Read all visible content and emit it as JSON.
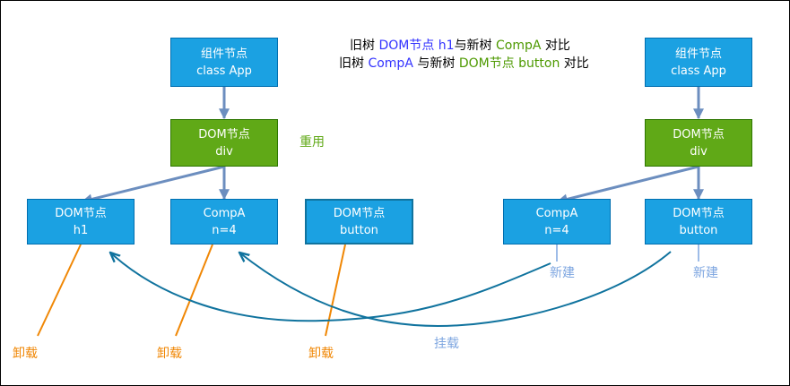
{
  "title": {
    "line1": {
      "p1": "旧树 ",
      "p2": "DOM节点 h1",
      "p3": "与新树 ",
      "p4": "CompA",
      "p5": " 对比"
    },
    "line2": {
      "p1": "旧树 ",
      "p2": "CompA",
      "p3": " 与新树 ",
      "p4": "DOM节点 button",
      "p5": " 对比"
    }
  },
  "old_tree": {
    "root": {
      "line1": "组件节点",
      "line2": "class App"
    },
    "div": {
      "line1": "DOM节点",
      "line2": "div"
    },
    "h1": {
      "line1": "DOM节点",
      "line2": "h1"
    },
    "compa": {
      "line1": "CompA",
      "line2": "n=4"
    },
    "button": {
      "line1": "DOM节点",
      "line2": "button"
    }
  },
  "new_tree": {
    "root": {
      "line1": "组件节点",
      "line2": "class App"
    },
    "div": {
      "line1": "DOM节点",
      "line2": "div"
    },
    "compa": {
      "line1": "CompA",
      "line2": "n=4"
    },
    "button": {
      "line1": "DOM节点",
      "line2": "button"
    }
  },
  "labels": {
    "reuse": "重用",
    "unmount_1": "卸载",
    "unmount_2": "卸载",
    "unmount_3": "卸载",
    "create_1": "新建",
    "create_2": "新建",
    "mount": "挂载"
  },
  "colors": {
    "node_blue": "#1ba1e2",
    "node_green": "#60a917",
    "edge": "#6c8ebf",
    "unmount": "#f08705",
    "create": "#7ea6e0",
    "mount_curve": "#10739e"
  }
}
